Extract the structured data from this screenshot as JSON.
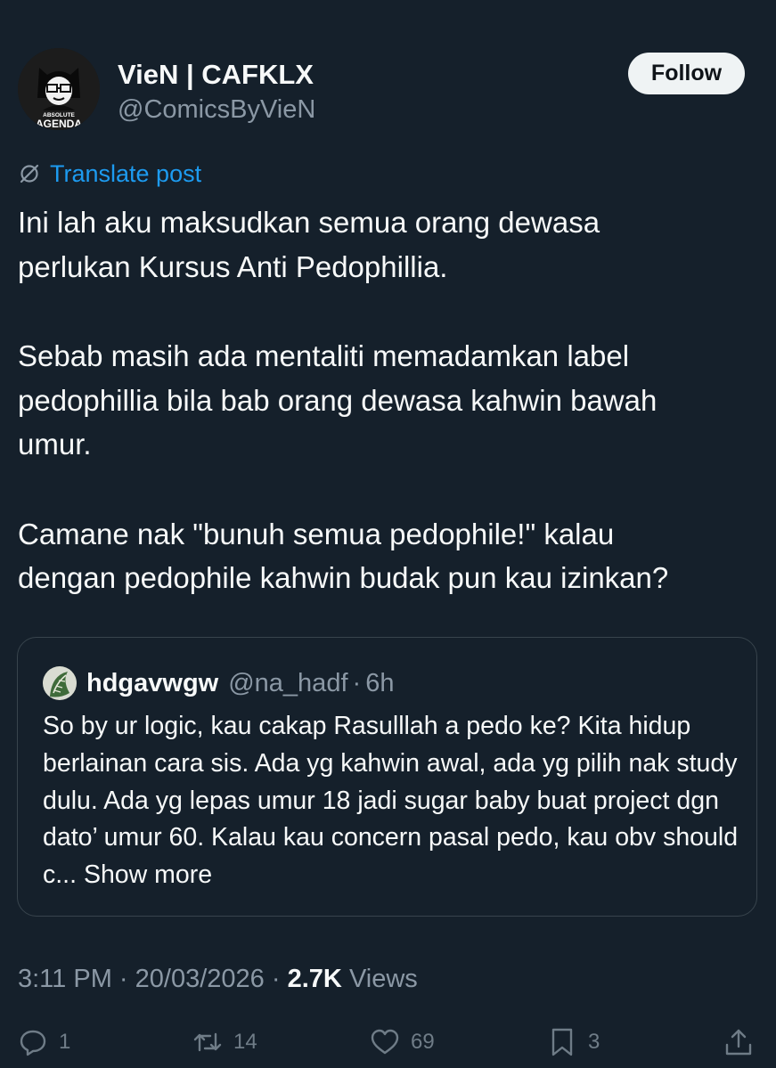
{
  "author": {
    "display_name": "VieN | CAFKLX",
    "handle": "@ComicsByVieN",
    "avatar_text_top": "ABSOLUTE",
    "avatar_text_bottom": "AGENDA"
  },
  "follow_label": "Follow",
  "translate_label": "Translate post",
  "post": {
    "paragraphs": [
      "Ini lah aku maksudkan semua orang dewasa\nperlukan Kursus Anti Pedophillia.",
      "Sebab masih ada mentaliti memadamkan label\npedophillia bila bab orang dewasa kahwin bawah\numur.",
      "Camane nak \"bunuh semua pedophile!\" kalau\ndengan pedophile kahwin budak pun kau izinkan?"
    ]
  },
  "quote": {
    "name": "hdgavwgw",
    "handle": "@na_hadf",
    "separator": "·",
    "time": "6h",
    "text": "So by ur logic, kau cakap Rasulllah a pedo ke? Kita hidup berlainan cara sis. Ada yg kahwin awal, ada yg pilih nak study dulu. Ada yg lepas umur 18 jadi sugar baby buat project dgn dato’ umur 60. Kalau kau concern pasal pedo, kau obv should c...",
    "show_more": "Show more"
  },
  "meta": {
    "time": "3:11 PM",
    "date": "20/03/2026",
    "separator": "·",
    "views_count": "2.7K",
    "views_label": "Views"
  },
  "actions": {
    "replies": "1",
    "reposts": "14",
    "likes": "69",
    "bookmarks": "3"
  },
  "colors": {
    "background": "#15202b",
    "text": "#f7f9f9",
    "muted": "#8b98a5",
    "link": "#1d9bf0",
    "border": "#38444d"
  },
  "icons": [
    "menu-fragment-icon",
    "translate-icon",
    "reply-icon",
    "repost-icon",
    "like-icon",
    "bookmark-icon",
    "share-icon"
  ]
}
